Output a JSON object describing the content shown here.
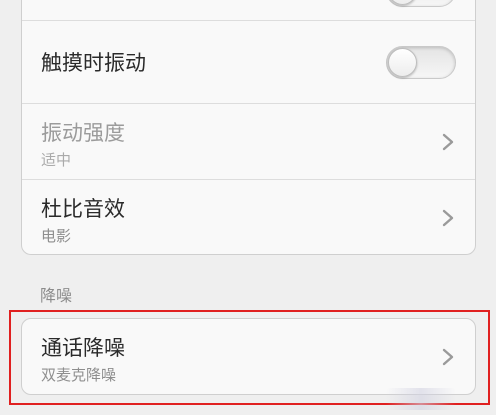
{
  "settings": {
    "touch_vibration": {
      "label": "触摸时振动",
      "enabled": false
    },
    "vibration_strength": {
      "label": "振动强度",
      "value": "适中"
    },
    "dolby": {
      "label": "杜比音效",
      "value": "电影"
    }
  },
  "noise_reduction": {
    "header": "降噪",
    "call_noise_reduction": {
      "label": "通话降噪",
      "value": "双麦克降噪"
    }
  },
  "colors": {
    "highlight": "#e02020",
    "background": "#efefef"
  }
}
